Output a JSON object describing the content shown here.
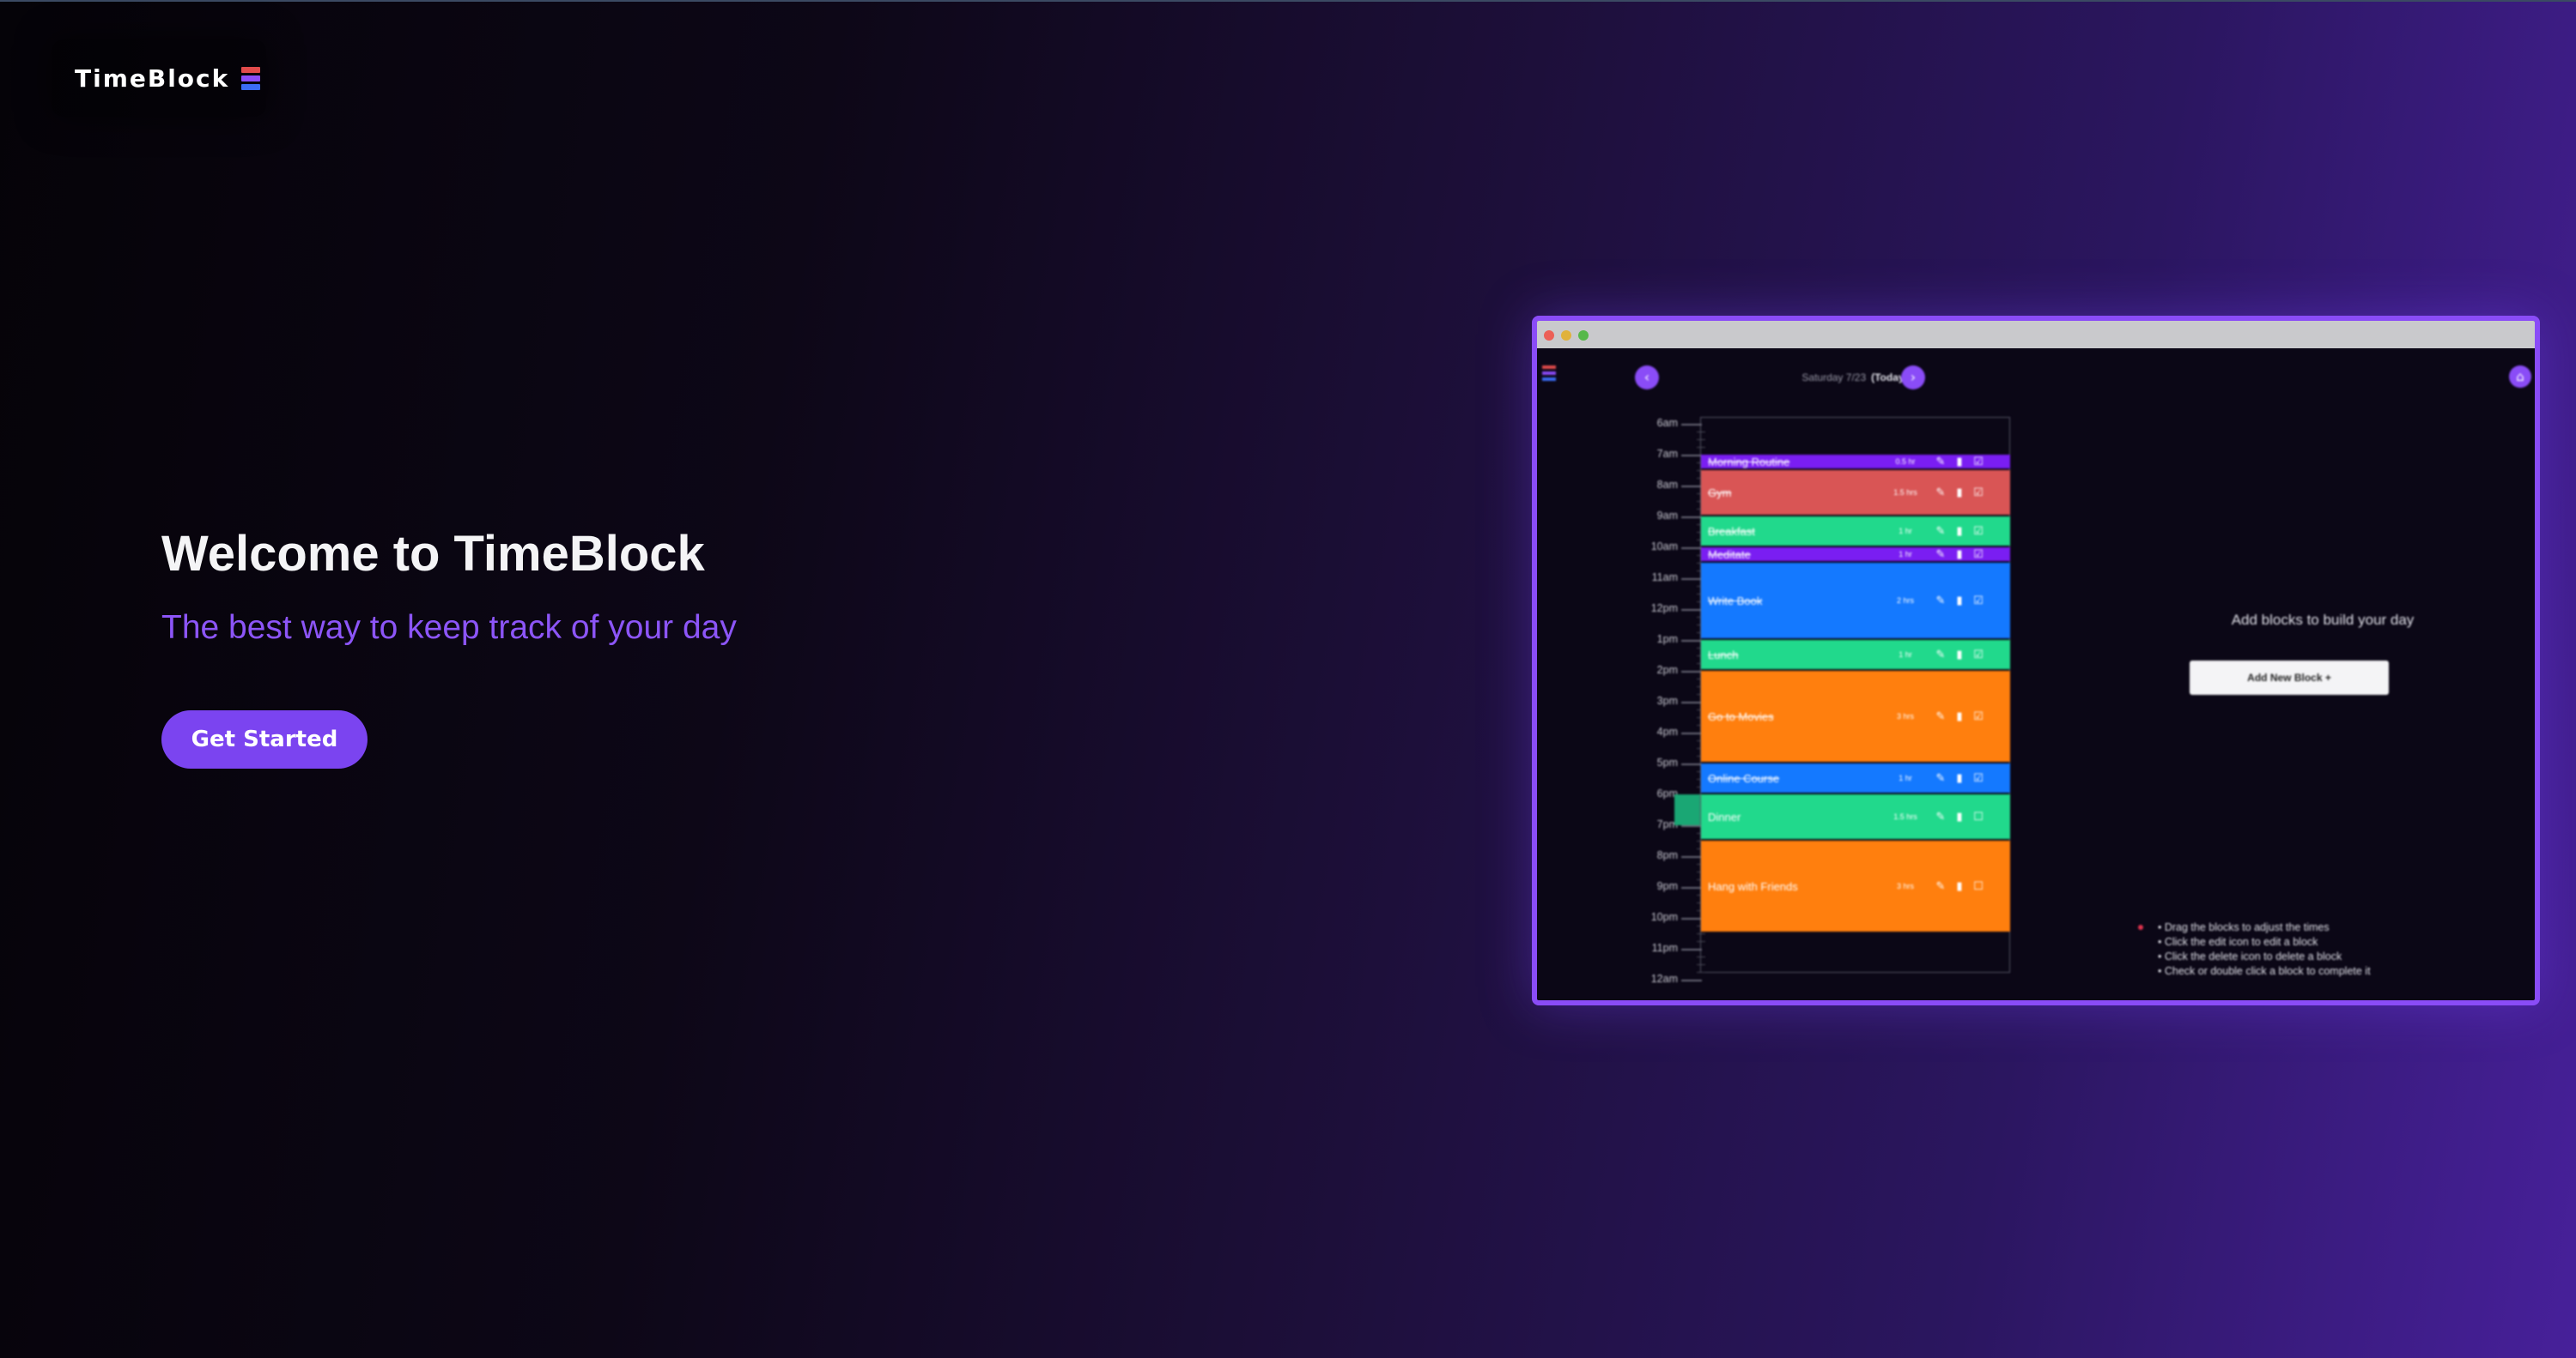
{
  "header": {
    "logo_text": "TimeBlock",
    "logo_icon": "stacked-blocks-icon",
    "logo_colors": [
      "#e14b4b",
      "#8b4cf7",
      "#3b6cf5"
    ]
  },
  "hero": {
    "title": "Welcome to TimeBlock",
    "subtitle": "The best way to keep track of your day",
    "cta_label": "Get Started"
  },
  "theme": {
    "accent": "#7b44f0",
    "subtitle_color": "#8c55f7"
  },
  "preview": {
    "date_label": "Saturday  7/23",
    "today_label": "(Today)",
    "prev_icon": "chevron-left-icon",
    "next_icon": "chevron-right-icon",
    "home_icon": "home-icon",
    "hours": [
      "6am",
      "7am",
      "8am",
      "9am",
      "10am",
      "11am",
      "12pm",
      "1pm",
      "2pm",
      "3pm",
      "4pm",
      "5pm",
      "6pm",
      "7pm",
      "8pm",
      "9pm",
      "10pm",
      "11pm",
      "12am"
    ],
    "blocks": [
      {
        "name": "Morning Routine",
        "duration": "0.5 hr",
        "start_hour": 7.0,
        "end_hour": 7.5,
        "color": "#7a1ef2",
        "done": true
      },
      {
        "name": "Gym",
        "duration": "1.5 hrs",
        "start_hour": 7.5,
        "end_hour": 9.0,
        "color": "#d95555",
        "done": true
      },
      {
        "name": "Breakfast",
        "duration": "1 hr",
        "start_hour": 9.0,
        "end_hour": 10.0,
        "color": "#21d98c",
        "done": true
      },
      {
        "name": "Meditate",
        "duration": "1 hr",
        "start_hour": 10.0,
        "end_hour": 10.5,
        "color": "#7a1ef2",
        "done": true
      },
      {
        "name": "Write Book",
        "duration": "2 hrs",
        "start_hour": 10.5,
        "end_hour": 13.0,
        "color": "#1479ff",
        "done": true
      },
      {
        "name": "Lunch",
        "duration": "1 hr",
        "start_hour": 13.0,
        "end_hour": 14.0,
        "color": "#21d98c",
        "done": true
      },
      {
        "name": "Go to Movies",
        "duration": "3 hrs",
        "start_hour": 14.0,
        "end_hour": 17.0,
        "color": "#ff7f0e",
        "done": true
      },
      {
        "name": "Online Course",
        "duration": "1 hr",
        "start_hour": 17.0,
        "end_hour": 18.0,
        "color": "#1479ff",
        "done": true
      },
      {
        "name": "Dinner",
        "duration": "1.5 hrs",
        "start_hour": 18.0,
        "end_hour": 19.5,
        "color": "#21d98c",
        "done": false
      },
      {
        "name": "Hang with Friends",
        "duration": "3 hrs",
        "start_hour": 19.5,
        "end_hour": 22.5,
        "color": "#ff7f0e",
        "done": false
      }
    ],
    "add_message": "Add blocks to build your day",
    "add_button_label": "Add New Block  +",
    "hints": [
      "• Drag the blocks to adjust the times",
      "• Click the edit icon to edit a block",
      "• Click the delete icon to delete a block",
      "• Check or double click a block to complete it"
    ]
  }
}
